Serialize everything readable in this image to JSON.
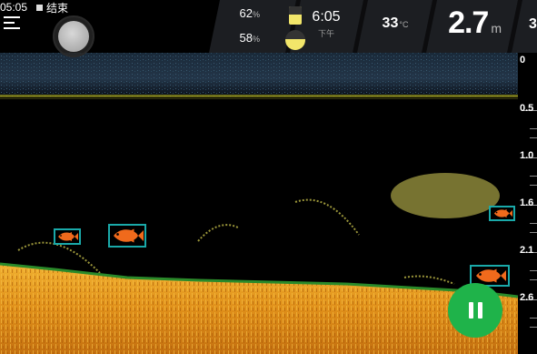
{
  "status_bar": {
    "time": "05:05",
    "recording_label": "结束"
  },
  "menu": {
    "icon": "hamburger-menu-icon"
  },
  "record_control": {
    "icon": "record-circle-icon"
  },
  "info_panel": {
    "phone_battery": {
      "value": "62",
      "unit": "%",
      "icon": "phone-battery-icon",
      "level": 0.62
    },
    "device_battery": {
      "value": "58",
      "unit": "%",
      "icon": "sonar-device-battery-icon",
      "level": 0.58
    },
    "time": "6:05",
    "time_period": "下午",
    "water_temp": {
      "value": "33",
      "unit": "°C"
    },
    "depth": {
      "value": "2.7",
      "unit": "m"
    },
    "next_panel_peek": "3"
  },
  "depth_scale": {
    "labels": [
      "0",
      "0.5",
      "1.0",
      "1.6",
      "2.1",
      "2.6"
    ]
  },
  "fish_markers": {
    "icon": "fish-icon",
    "count": 4
  },
  "controls": {
    "pause_icon": "pause-icon"
  },
  "colors": {
    "bottom_fill": "#e39a1a",
    "bottom_edge": "#2a8a2a",
    "echo": "#d8d25a",
    "fish": "#f06a1c",
    "fish_box": "#1aa9a9",
    "pause": "#1fb34a",
    "surface_band": "#1e3040"
  }
}
